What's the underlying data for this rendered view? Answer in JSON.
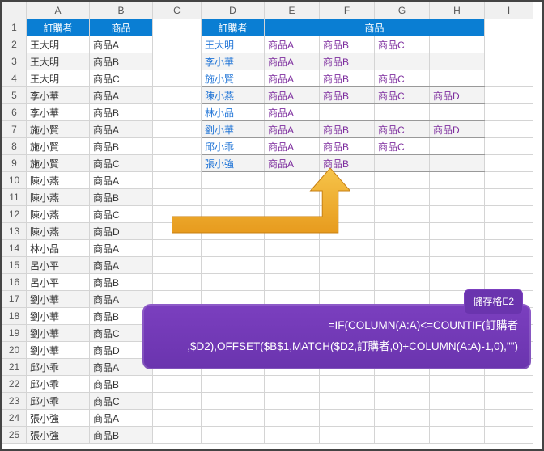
{
  "columns": [
    "A",
    "B",
    "C",
    "D",
    "E",
    "F",
    "G",
    "H",
    "I"
  ],
  "rownums": [
    "1",
    "2",
    "3",
    "4",
    "5",
    "6",
    "7",
    "8",
    "9",
    "10",
    "11",
    "12",
    "13",
    "14",
    "15",
    "16",
    "17",
    "18",
    "19",
    "20",
    "21",
    "22",
    "23",
    "24",
    "25"
  ],
  "left_header": {
    "a": "訂購者",
    "b": "商品"
  },
  "left_rows": [
    {
      "a": "王大明",
      "b": "商品A"
    },
    {
      "a": "王大明",
      "b": "商品B"
    },
    {
      "a": "王大明",
      "b": "商品C"
    },
    {
      "a": "李小華",
      "b": "商品A"
    },
    {
      "a": "李小華",
      "b": "商品B"
    },
    {
      "a": "施小賢",
      "b": "商品A"
    },
    {
      "a": "施小賢",
      "b": "商品B"
    },
    {
      "a": "施小賢",
      "b": "商品C"
    },
    {
      "a": "陳小燕",
      "b": "商品A"
    },
    {
      "a": "陳小燕",
      "b": "商品B"
    },
    {
      "a": "陳小燕",
      "b": "商品C"
    },
    {
      "a": "陳小燕",
      "b": "商品D"
    },
    {
      "a": "林小品",
      "b": "商品A"
    },
    {
      "a": "呂小平",
      "b": "商品A"
    },
    {
      "a": "呂小平",
      "b": "商品B"
    },
    {
      "a": "劉小華",
      "b": "商品A"
    },
    {
      "a": "劉小華",
      "b": "商品B"
    },
    {
      "a": "劉小華",
      "b": "商品C"
    },
    {
      "a": "劉小華",
      "b": "商品D"
    },
    {
      "a": "邱小乖",
      "b": "商品A"
    },
    {
      "a": "邱小乖",
      "b": "商品B"
    },
    {
      "a": "邱小乖",
      "b": "商品C"
    },
    {
      "a": "張小強",
      "b": "商品A"
    },
    {
      "a": "張小強",
      "b": "商品B"
    }
  ],
  "right_header": {
    "d": "訂購者",
    "efgh": "商品"
  },
  "right_rows": [
    {
      "d": "王大明",
      "e": "商品A",
      "f": "商品B",
      "g": "商品C",
      "h": ""
    },
    {
      "d": "李小華",
      "e": "商品A",
      "f": "商品B",
      "g": "",
      "h": ""
    },
    {
      "d": "施小賢",
      "e": "商品A",
      "f": "商品B",
      "g": "商品C",
      "h": ""
    },
    {
      "d": "陳小燕",
      "e": "商品A",
      "f": "商品B",
      "g": "商品C",
      "h": "商品D"
    },
    {
      "d": "林小品",
      "e": "商品A",
      "f": "",
      "g": "",
      "h": ""
    },
    {
      "d": "劉小華",
      "e": "商品A",
      "f": "商品B",
      "g": "商品C",
      "h": "商品D"
    },
    {
      "d": "邱小乖",
      "e": "商品A",
      "f": "商品B",
      "g": "商品C",
      "h": ""
    },
    {
      "d": "張小強",
      "e": "商品A",
      "f": "商品B",
      "g": "",
      "h": ""
    }
  ],
  "formula": {
    "label": "儲存格E2",
    "line1": "=IF(COLUMN(A:A)<=COUNTIF(訂購者",
    "line2": ",$D2),OFFSET($B$1,MATCH($D2,訂購者,0)+COLUMN(A:A)-1,0),\"\")"
  }
}
